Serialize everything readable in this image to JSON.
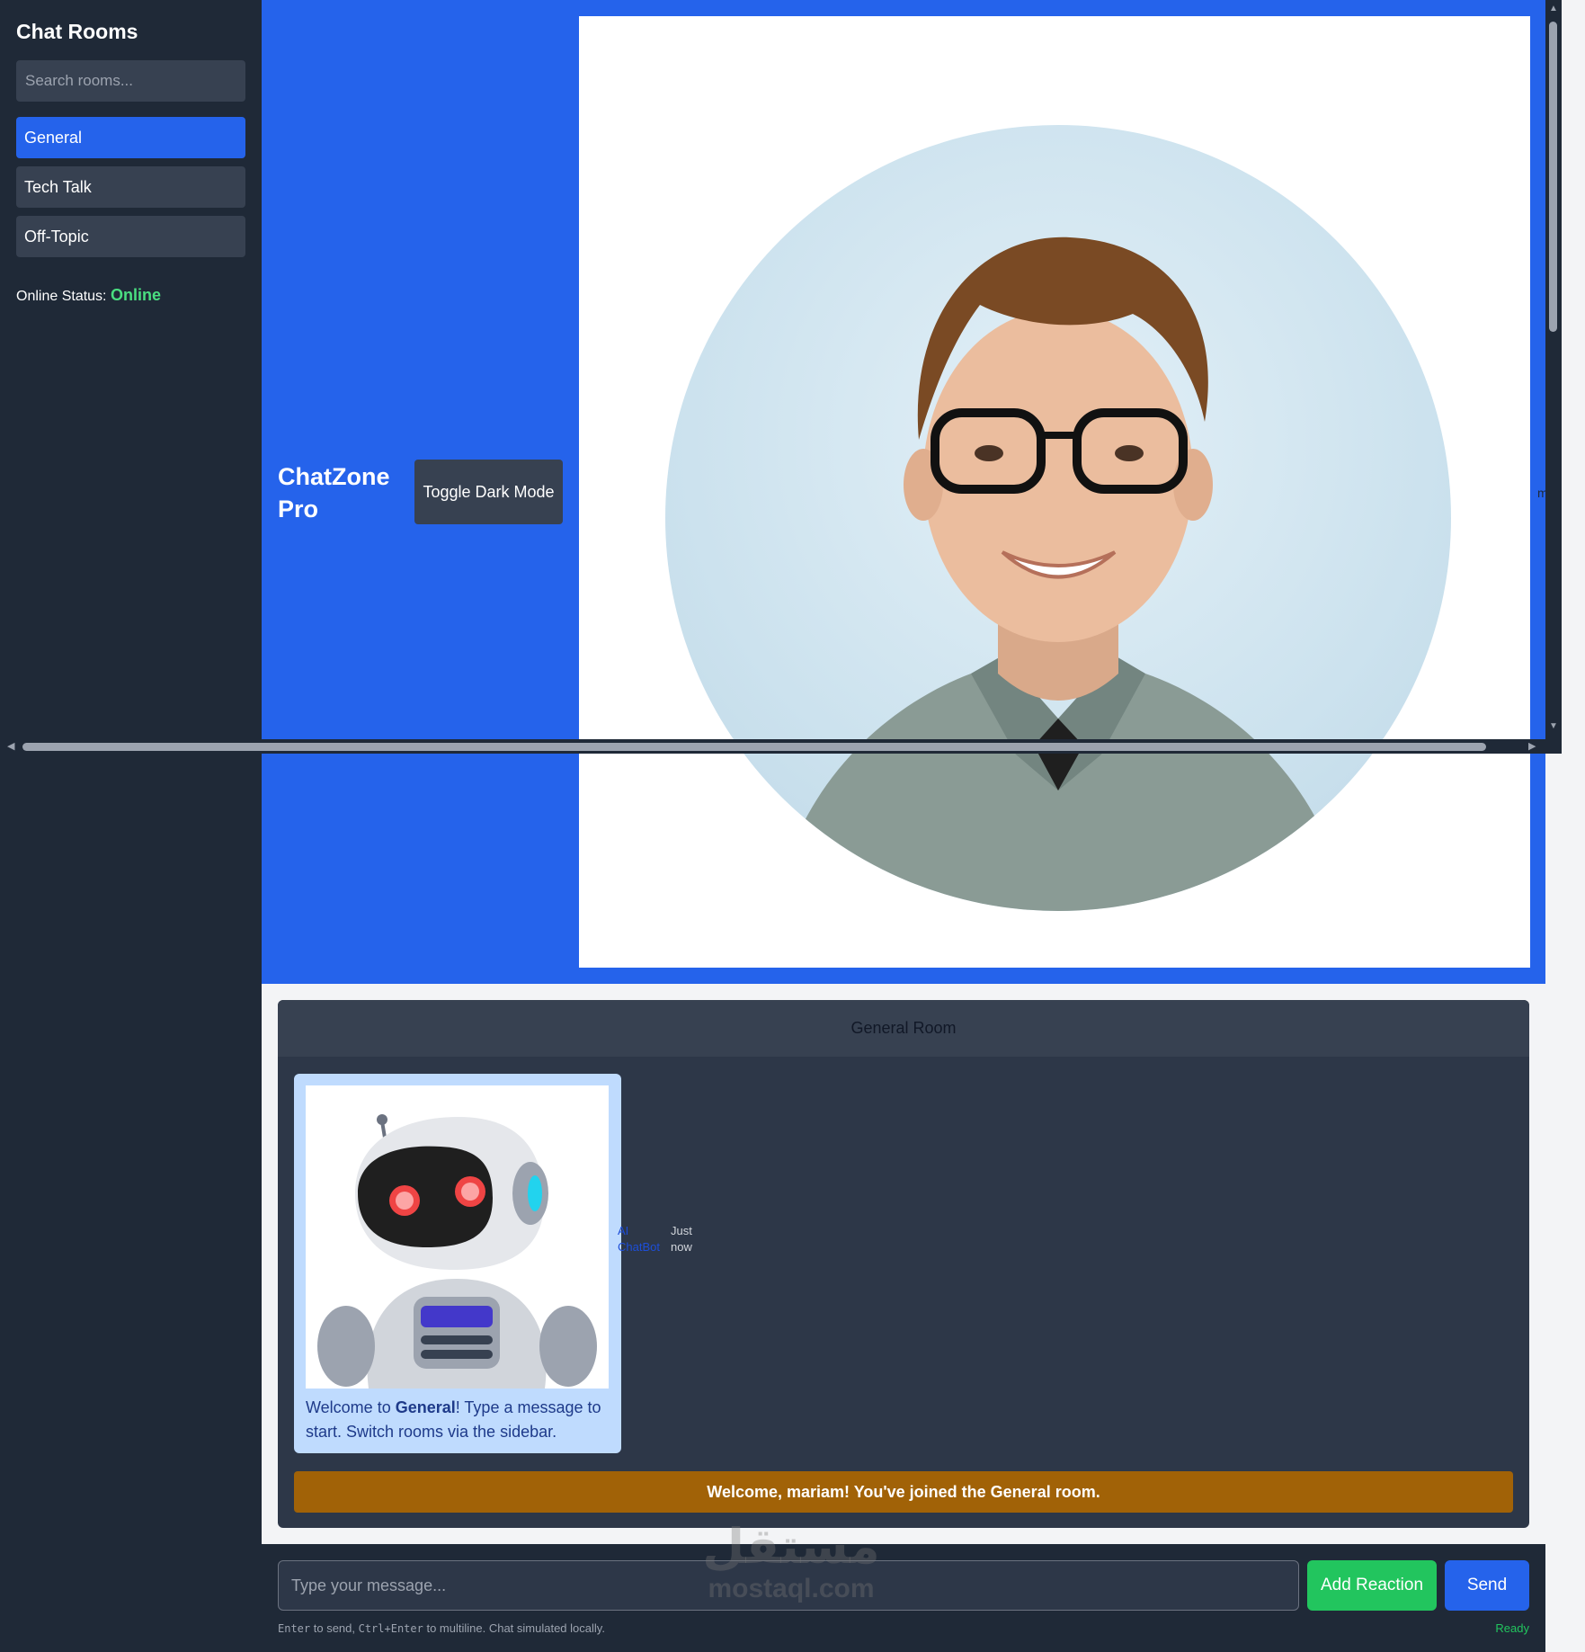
{
  "sidebar": {
    "title": "Chat Rooms",
    "search_placeholder": "Search rooms...",
    "rooms": [
      {
        "label": "General",
        "active": true
      },
      {
        "label": "Tech Talk",
        "active": false
      },
      {
        "label": "Off-Topic",
        "active": false
      }
    ],
    "status_label": "Online Status:",
    "status_value": "Online"
  },
  "header": {
    "brand": "ChatZone Pro",
    "toggle_label": "Toggle Dark Mode",
    "overflow_label": "m",
    "profile_image": "profile-photo"
  },
  "chat": {
    "room_title": "General Room",
    "message": {
      "image": "robot-avatar",
      "text_before": "Welcome to ",
      "room_bold": "General",
      "text_after": "! Type a message to start. Switch rooms via the sidebar.",
      "author": "AI ChatBot",
      "time": "Just now"
    },
    "join_banner": "Welcome, mariam! You've joined the General room."
  },
  "composer": {
    "placeholder": "Type your message...",
    "reaction_label": "Add Reaction",
    "send_label": "Send",
    "hint_enter": "Enter",
    "hint_mid": " to send, ",
    "hint_ctrl": "Ctrl+Enter",
    "hint_end": " to multiline. Chat simulated locally.",
    "ready": "Ready"
  },
  "watermark": {
    "arabic": "مستقل",
    "latin": "mostaql.com"
  },
  "colors": {
    "accent": "#2563eb",
    "sidebar_bg": "#1f2937",
    "online": "#4ade80",
    "banner": "#a16207",
    "reaction": "#22c55e"
  }
}
